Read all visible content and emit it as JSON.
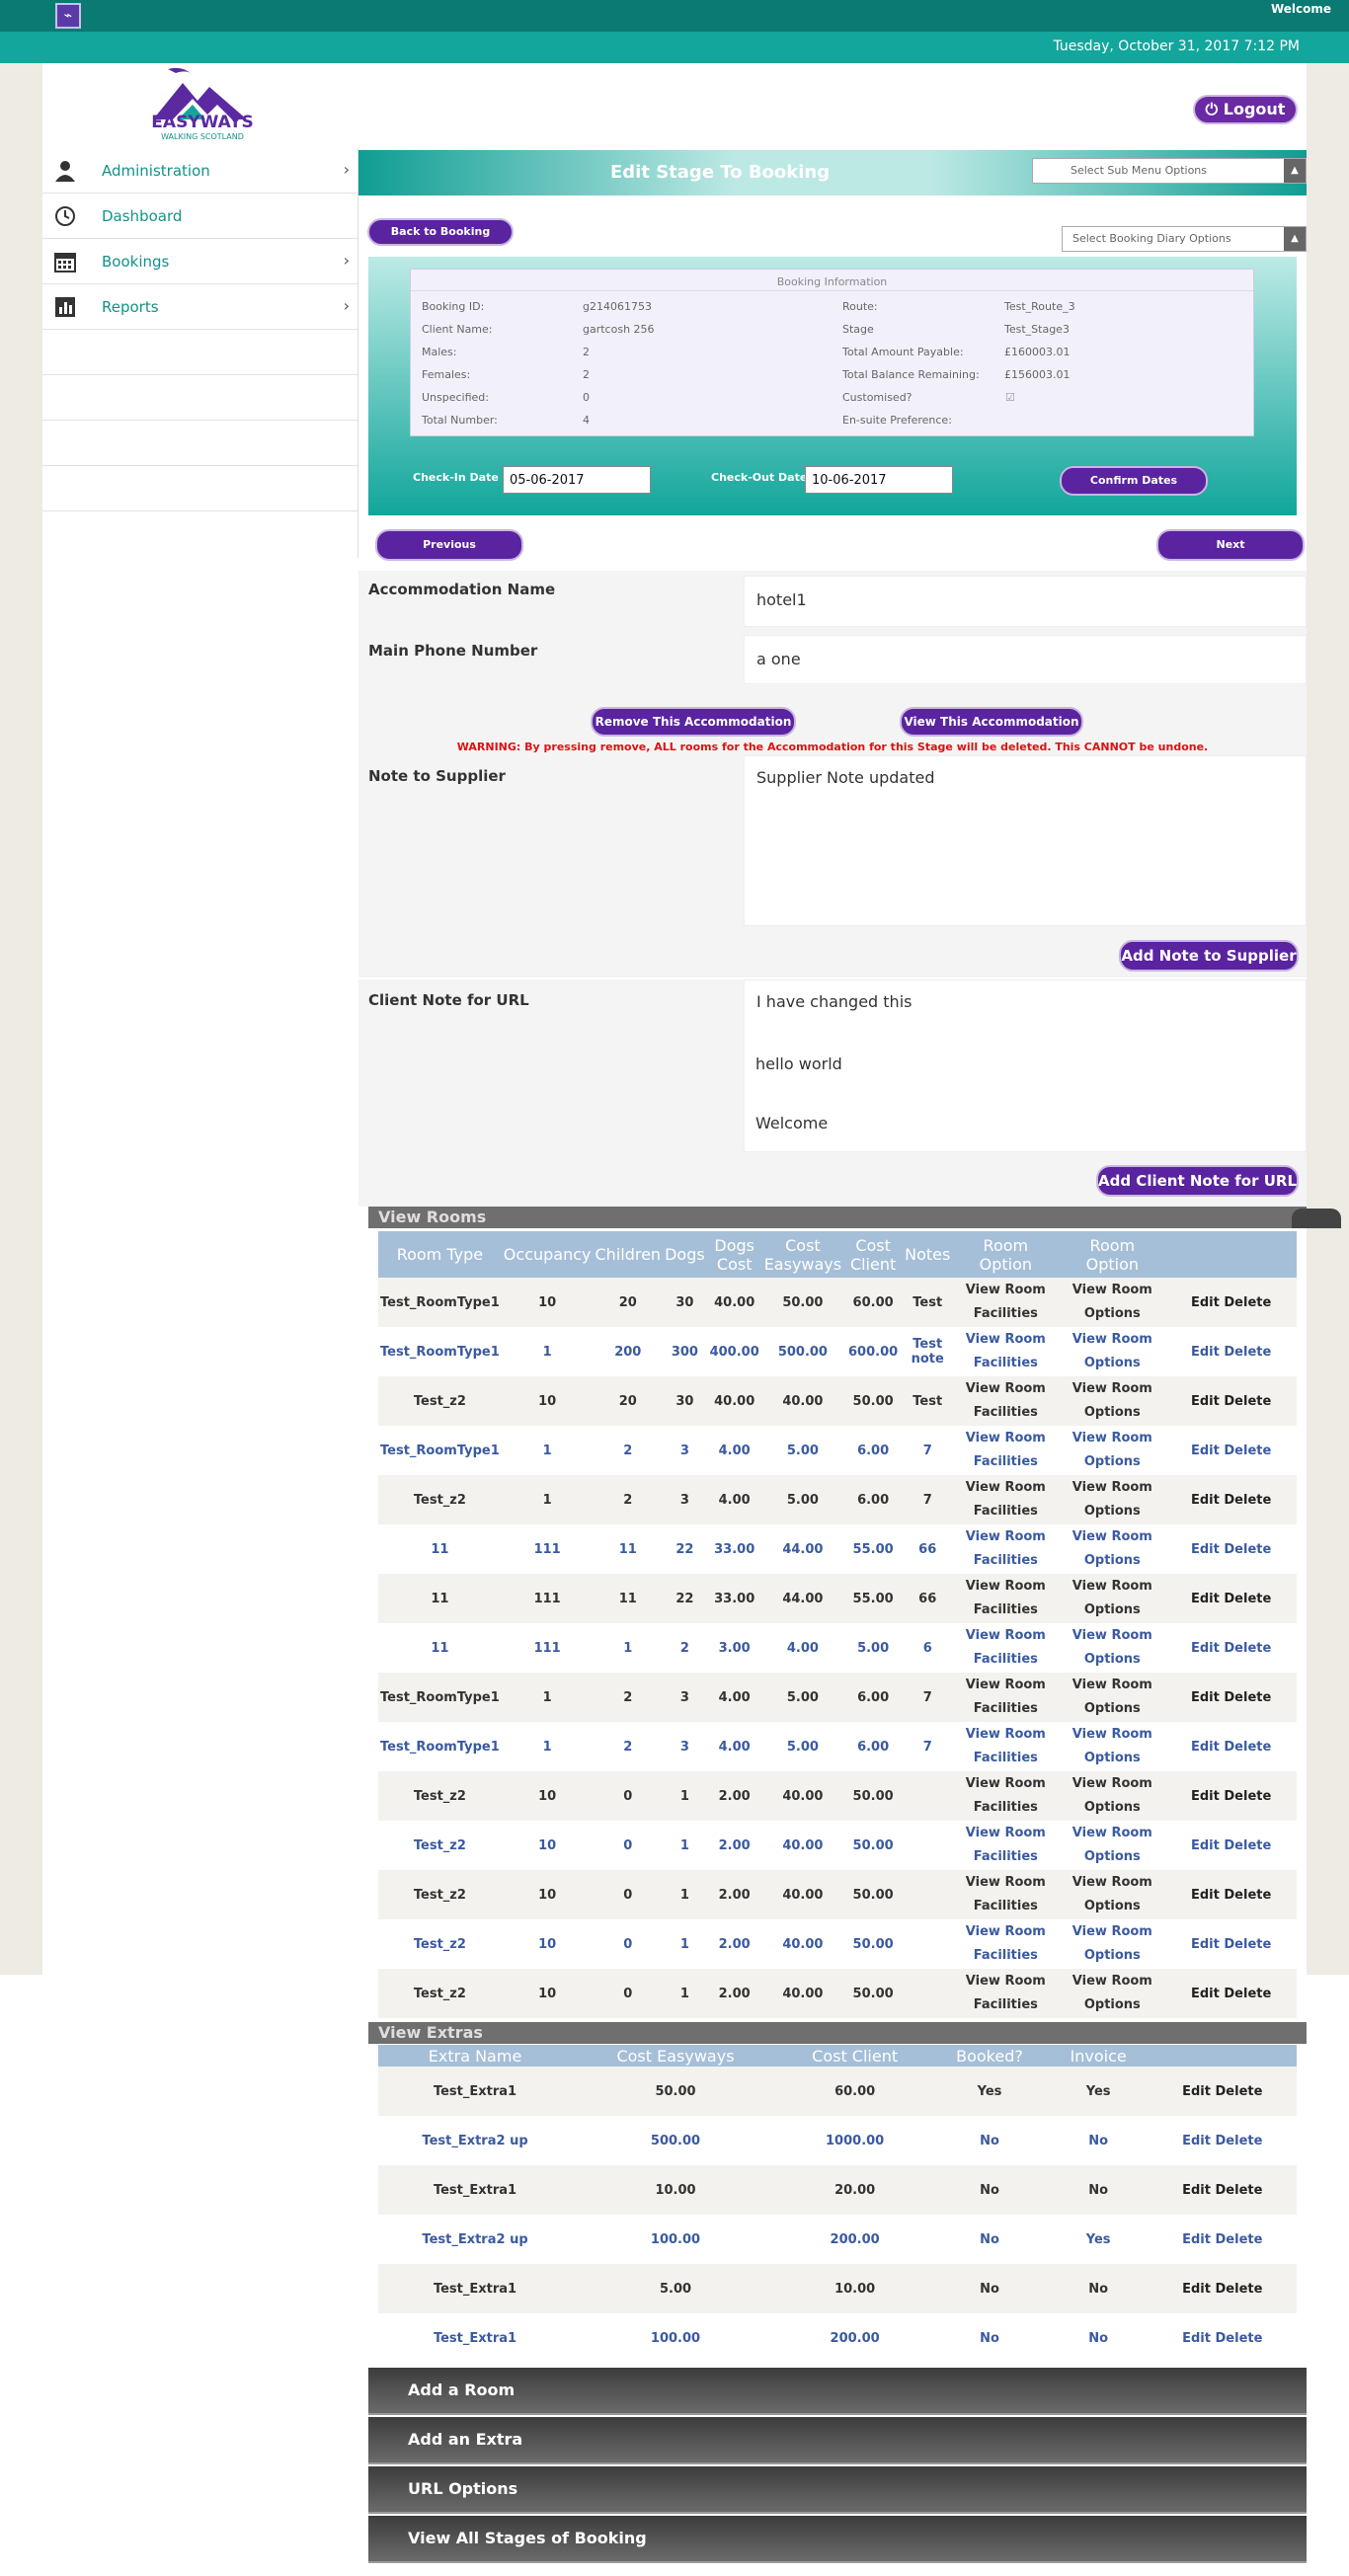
{
  "topbar": {
    "welcome": "Welcome"
  },
  "datebar": {
    "datetime": "Tuesday, October 31, 2017 7:12 PM"
  },
  "logo": {
    "line1": "EASYWAYS",
    "line2": "WALKING SCOTLAND"
  },
  "header": {
    "logout_label": "Logout",
    "title": "Edit Stage To Booking",
    "submenu_placeholder": "Select Sub Menu Options",
    "diary_placeholder": "Select Booking Diary Options"
  },
  "sidebar": {
    "items": [
      {
        "label": "Administration",
        "icon": "user-icon",
        "has_arrow": true
      },
      {
        "label": "Dashboard",
        "icon": "clock-icon",
        "has_arrow": false
      },
      {
        "label": "Bookings",
        "icon": "calendar-icon",
        "has_arrow": true
      },
      {
        "label": "Reports",
        "icon": "bar-chart-icon",
        "has_arrow": true
      }
    ]
  },
  "buttons": {
    "back_to_booking": "Back to Booking",
    "confirm_dates": "Confirm Dates",
    "previous": "Previous",
    "next": "Next",
    "remove_accommodation": "Remove This Accommodation",
    "view_accommodation": "View This Accommodation",
    "add_note_supplier": "Add Note to Supplier",
    "add_client_note": "Add Client Note for URL"
  },
  "booking_info": {
    "title": "Booking Information",
    "left": [
      {
        "label": "Booking ID:",
        "value": "g214061753"
      },
      {
        "label": "Client Name:",
        "value": "gartcosh 256"
      },
      {
        "label": "Males:",
        "value": "2"
      },
      {
        "label": "Females:",
        "value": "2"
      },
      {
        "label": "Unspecified:",
        "value": "0"
      },
      {
        "label": "Total Number:",
        "value": "4"
      }
    ],
    "right": [
      {
        "label": "Route:",
        "value": "Test_Route_3"
      },
      {
        "label": "Stage",
        "value": "Test_Stage3"
      },
      {
        "label": "Total Amount Payable:",
        "value": "£160003.01"
      },
      {
        "label": "Total Balance Remaining:",
        "value": "£156003.01"
      },
      {
        "label": "Customised?",
        "value": ""
      },
      {
        "label": "En-suite Preference:",
        "value": ""
      }
    ]
  },
  "dates": {
    "checkin_label": "Check-In Date",
    "checkin_value": "05-06-2017",
    "checkout_label": "Check-Out Date",
    "checkout_value": "10-06-2017"
  },
  "accommodation": {
    "name_label": "Accommodation Name",
    "name_value": "hotel1",
    "phone_label": "Main Phone Number",
    "phone_value": "a one",
    "warning": "WARNING: By pressing remove, ALL rooms for the Accommodation for this Stage will be deleted. This CANNOT be undone.",
    "supplier_label": "Note to Supplier",
    "supplier_value": "Supplier Note updated",
    "client_label": "Client Note for URL",
    "client_lines": [
      "I have changed this",
      "hello world",
      "Welcome"
    ]
  },
  "rooms": {
    "section_title": "View Rooms",
    "headers": [
      "Room Type",
      "Occupancy",
      "Children",
      "Dogs",
      "Dogs Cost",
      "Cost Easyways",
      "Cost Client",
      "Notes",
      "Room Option",
      "Room Option"
    ],
    "facilities_label": "View Room Facilities",
    "options_label": "View Room Options",
    "edit_label": "Edit",
    "delete_label": "Delete",
    "rows": [
      [
        "Test_RoomType1",
        "10",
        "20",
        "30",
        "40.00",
        "50.00",
        "60.00",
        "Test"
      ],
      [
        "Test_RoomType1",
        "1",
        "200",
        "300",
        "400.00",
        "500.00",
        "600.00",
        "Test note"
      ],
      [
        "Test_z2",
        "10",
        "20",
        "30",
        "40.00",
        "40.00",
        "50.00",
        "Test"
      ],
      [
        "Test_RoomType1",
        "1",
        "2",
        "3",
        "4.00",
        "5.00",
        "6.00",
        "7"
      ],
      [
        "Test_z2",
        "1",
        "2",
        "3",
        "4.00",
        "5.00",
        "6.00",
        "7"
      ],
      [
        "11",
        "111",
        "11",
        "22",
        "33.00",
        "44.00",
        "55.00",
        "66"
      ],
      [
        "11",
        "111",
        "11",
        "22",
        "33.00",
        "44.00",
        "55.00",
        "66"
      ],
      [
        "11",
        "111",
        "1",
        "2",
        "3.00",
        "4.00",
        "5.00",
        "6"
      ],
      [
        "Test_RoomType1",
        "1",
        "2",
        "3",
        "4.00",
        "5.00",
        "6.00",
        "7"
      ],
      [
        "Test_RoomType1",
        "1",
        "2",
        "3",
        "4.00",
        "5.00",
        "6.00",
        "7"
      ],
      [
        "Test_z2",
        "10",
        "0",
        "1",
        "2.00",
        "40.00",
        "50.00",
        ""
      ],
      [
        "Test_z2",
        "10",
        "0",
        "1",
        "2.00",
        "40.00",
        "50.00",
        ""
      ],
      [
        "Test_z2",
        "10",
        "0",
        "1",
        "2.00",
        "40.00",
        "50.00",
        ""
      ],
      [
        "Test_z2",
        "10",
        "0",
        "1",
        "2.00",
        "40.00",
        "50.00",
        ""
      ],
      [
        "Test_z2",
        "10",
        "0",
        "1",
        "2.00",
        "40.00",
        "50.00",
        ""
      ]
    ]
  },
  "extras": {
    "section_title": "View Extras",
    "headers": [
      "Extra Name",
      "Cost Easyways",
      "Cost Client",
      "Booked?",
      "Invoice"
    ],
    "rows": [
      [
        "Test_Extra1",
        "50.00",
        "60.00",
        "Yes",
        "Yes"
      ],
      [
        "Test_Extra2 up",
        "500.00",
        "1000.00",
        "No",
        "No"
      ],
      [
        "Test_Extra1",
        "10.00",
        "20.00",
        "No",
        "No"
      ],
      [
        "Test_Extra2 up",
        "100.00",
        "200.00",
        "No",
        "Yes"
      ],
      [
        "Test_Extra1",
        "5.00",
        "10.00",
        "No",
        "No"
      ],
      [
        "Test_Extra1",
        "100.00",
        "200.00",
        "No",
        "No"
      ]
    ]
  },
  "accordion": [
    "Add a Room",
    "Add an Extra",
    "URL Options",
    "View All Stages of Booking"
  ],
  "colors": {
    "teal": "#0a7a73",
    "purple": "#5a23a0",
    "table_header": "#a6bfd8"
  }
}
